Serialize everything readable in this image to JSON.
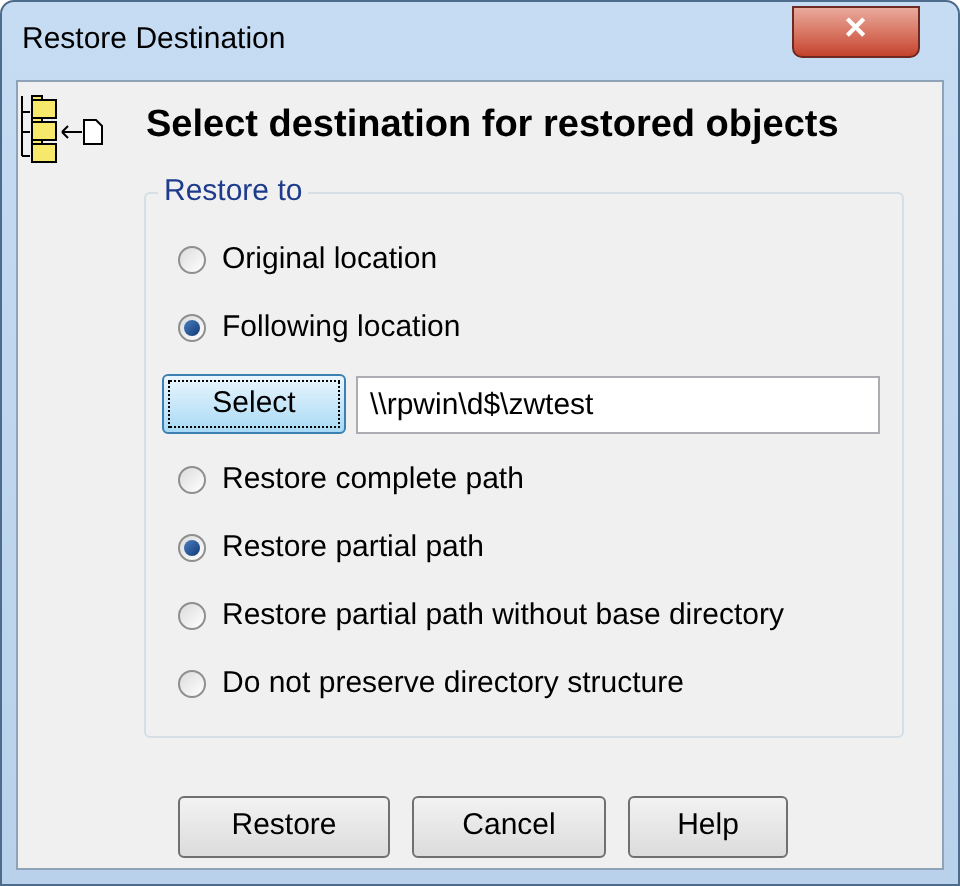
{
  "window": {
    "title": "Restore Destination",
    "close_label": "✕"
  },
  "heading": "Select destination for restored objects",
  "group": {
    "title": "Restore to",
    "rows": [
      {
        "kind": "radio",
        "label": "Original location",
        "selected": false
      },
      {
        "kind": "radio",
        "label": "Following location",
        "selected": true
      },
      {
        "kind": "path",
        "button": "Select",
        "value": "\\\\rpwin\\d$\\zwtest"
      },
      {
        "kind": "radio",
        "label": "Restore complete path",
        "selected": false
      },
      {
        "kind": "radio",
        "label": "Restore partial path",
        "selected": true
      },
      {
        "kind": "radio",
        "label": "Restore partial path without base directory",
        "selected": false
      },
      {
        "kind": "radio",
        "label": "Do not preserve directory structure",
        "selected": false
      }
    ]
  },
  "buttons": [
    "Restore",
    "Cancel",
    "Help"
  ]
}
